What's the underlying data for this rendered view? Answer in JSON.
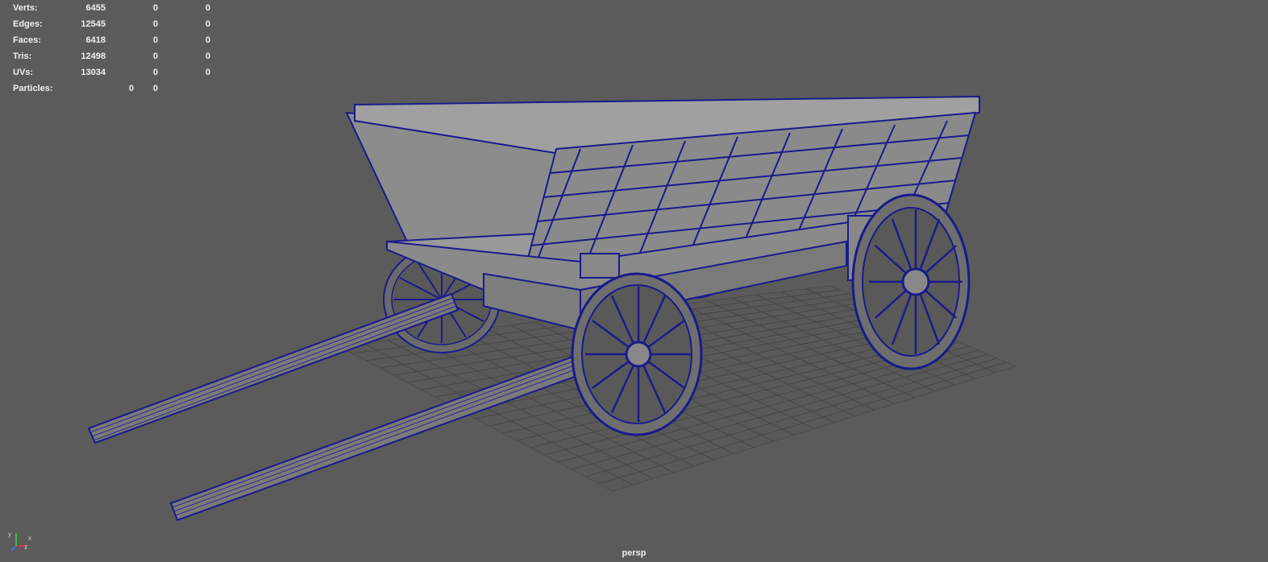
{
  "hud": {
    "rows": [
      {
        "label": "Verts:",
        "v1": "6455",
        "v2": "0",
        "v3": "0"
      },
      {
        "label": "Edges:",
        "v1": "12545",
        "v2": "0",
        "v3": "0"
      },
      {
        "label": "Faces:",
        "v1": "6418",
        "v2": "0",
        "v3": "0"
      },
      {
        "label": "Tris:",
        "v1": "12498",
        "v2": "0",
        "v3": "0"
      },
      {
        "label": "UVs:",
        "v1": "13034",
        "v2": "0",
        "v3": "0"
      },
      {
        "label": "Particles:",
        "v1": "0",
        "v2": "0"
      }
    ]
  },
  "viewport": {
    "camera": "persp",
    "background_color": "#5b5b5b",
    "wire_color": "#1a1a8c",
    "grid_color": "#4a4a4a"
  },
  "axis": {
    "x_label": "x",
    "y_label": "y",
    "z_label": "z"
  }
}
